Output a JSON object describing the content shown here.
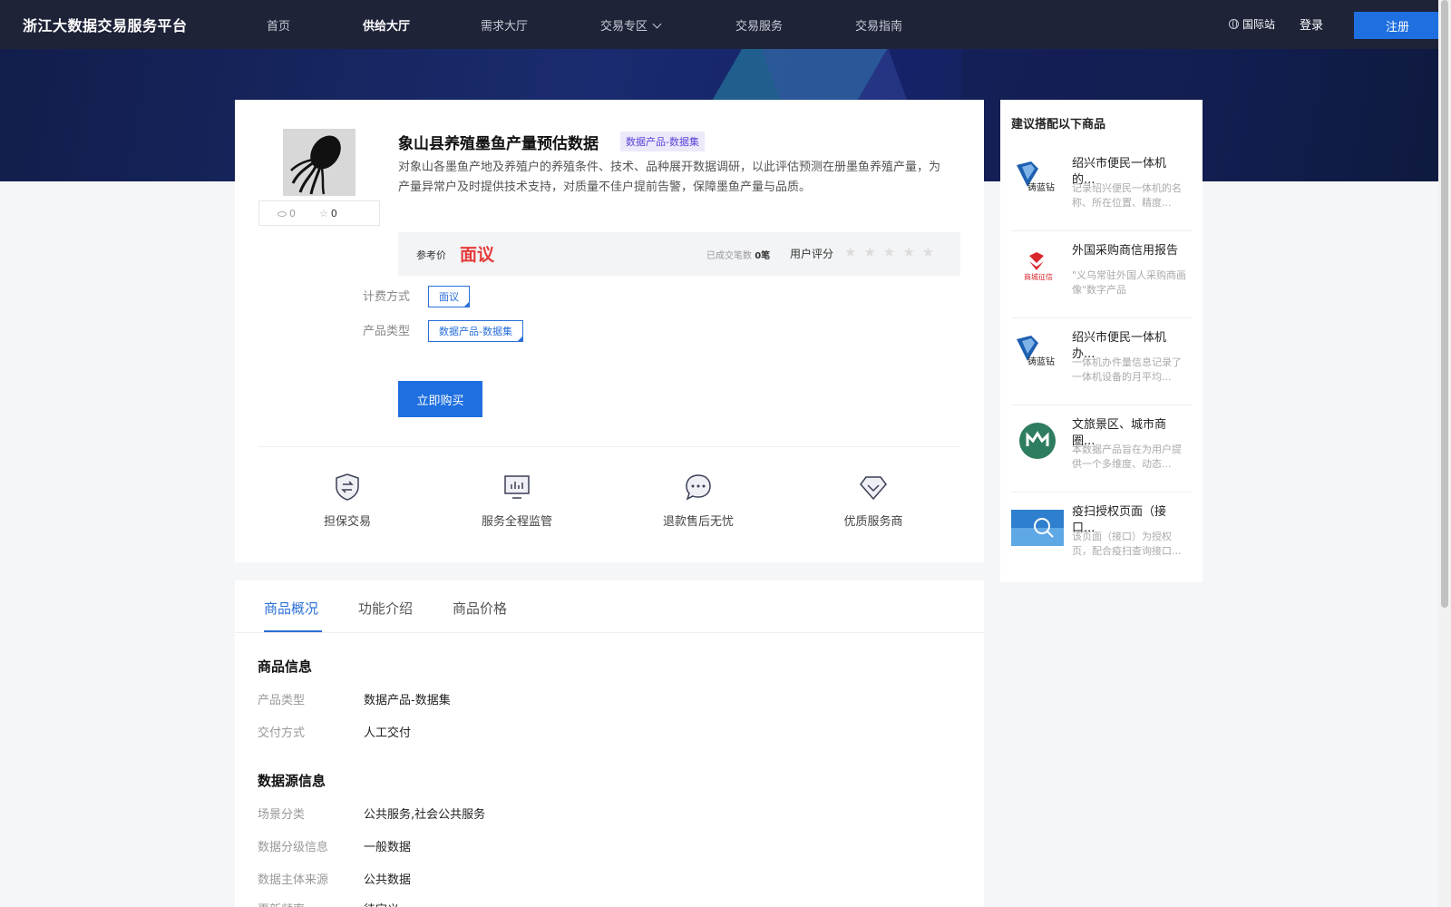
{
  "brand": {
    "name": "浙江大数据交易服务平台"
  },
  "nav": {
    "items": [
      "首页",
      "供给大厅",
      "需求大厅",
      "交易专区",
      "交易服务",
      "交易指南"
    ],
    "intl_label": "国际站",
    "login_label": "登录",
    "register_label": "注册"
  },
  "product": {
    "title": "象山县养殖墨鱼产量预估数据",
    "tag": "数据产品-数据集",
    "description": "对象山各墨鱼产地及养殖户的养殖条件、技术、品种展开数据调研，以此评估预测在册墨鱼养殖产量，为产量异常户及时提供技术支持，对质量不佳户提前告警，保障墨鱼产量与品质。",
    "views": "0",
    "favorites": "0",
    "price_label": "参考价",
    "price_value": "面议",
    "deals_label": "已成交笔数",
    "deals_value": "0笔",
    "rating_label": "用户评分",
    "rating": 0,
    "billing_label": "计费方式",
    "billing_value": "面议",
    "type_label": "产品类型",
    "type_value": "数据产品-数据集",
    "buy_label": "立即购买"
  },
  "features": [
    {
      "label": "担保交易",
      "icon": "shield-swap-icon"
    },
    {
      "label": "服务全程监管",
      "icon": "monitor-chart-icon"
    },
    {
      "label": "退款售后无忧",
      "icon": "chat-bubble-icon"
    },
    {
      "label": "优质服务商",
      "icon": "diamond-icon"
    }
  ],
  "recommend": {
    "title": "建议搭配以下商品",
    "items": [
      {
        "name": "绍兴市便民一体机的...",
        "desc": "记录绍兴便民一体机的名称、所在位置、精度...",
        "icon": "diamond-logo-icon"
      },
      {
        "name": "外国采购商信用报告",
        "desc": "\"义乌常驻外国人采购商画像\"数字产品",
        "icon": "credit-logo-icon"
      },
      {
        "name": "绍兴市便民一体机办...",
        "desc": "一体机办件量信息记录了一体机设备的月平均...",
        "icon": "diamond-logo-icon"
      },
      {
        "name": "文旅景区、城市商圈...",
        "desc": "本数据产品旨在为用户提供一个多维度、动态...",
        "icon": "m-circle-logo-icon"
      },
      {
        "name": "疫扫授权页面（接口...",
        "desc": "该页面（接口）为授权页，配合疫扫查询接口...",
        "icon": "search-image-icon"
      }
    ]
  },
  "tabs": [
    "商品概况",
    "功能介绍",
    "商品价格"
  ],
  "info": {
    "section1_title": "商品信息",
    "rows1": [
      {
        "label": "产品类型",
        "value": "数据产品-数据集"
      },
      {
        "label": "交付方式",
        "value": "人工交付"
      }
    ],
    "section2_title": "数据源信息",
    "rows2": [
      {
        "label": "场景分类",
        "value": "公共服务,社会公共服务"
      },
      {
        "label": "数据分级信息",
        "value": "一般数据"
      },
      {
        "label": "数据主体来源",
        "value": "公共数据"
      },
      {
        "label": "更新频率",
        "value": "待定义"
      }
    ]
  },
  "colors": {
    "accent": "#1e6fe0",
    "price": "#e63a3a",
    "header": "#1e2338"
  }
}
